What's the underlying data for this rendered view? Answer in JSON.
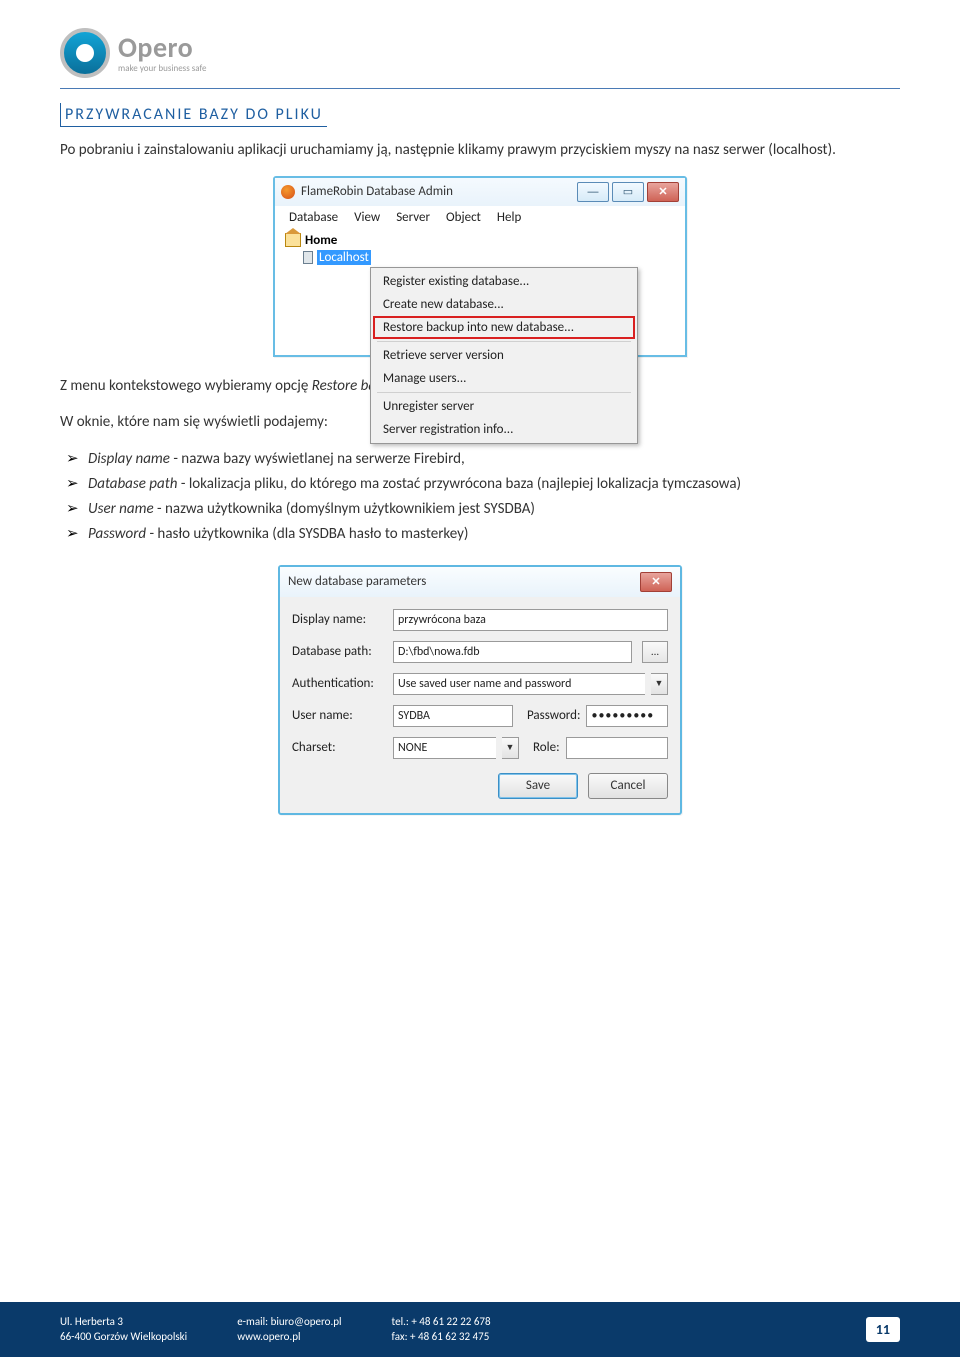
{
  "logo": {
    "brand": "Opero",
    "tagline": "make your business safe"
  },
  "section_title": "PRZYWRACANIE BAZY DO PLIKU",
  "para_intro": "Po pobraniu i zainstalowaniu aplikacji uruchamiamy ją, następnie klikamy prawym przyciskiem myszy na nasz serwer (localhost).",
  "flamerobin": {
    "title": "FlameRobin Database Admin",
    "menu": [
      "Database",
      "View",
      "Server",
      "Object",
      "Help"
    ],
    "tree": {
      "root": "Home",
      "selected": "Localhost"
    },
    "context": {
      "g1": [
        "Register existing database...",
        "Create new database..."
      ],
      "highlight": "Restore backup into new database...",
      "g2": [
        "Retrieve server version",
        "Manage users..."
      ],
      "g3": [
        "Unregister server",
        "Server registration info..."
      ]
    }
  },
  "para_mid": "Z menu kontekstowego wybieramy opcję ",
  "para_mid_em": "Restore backup into new database...",
  "para_list_intro": "W oknie, które nam się wyświetli podajemy:",
  "bullets": [
    {
      "em": "Display name",
      "rest": " - nazwa bazy wyświetlanej na serwerze Firebird,"
    },
    {
      "em": "Database path",
      "rest": " - lokalizacja pliku, do którego ma zostać przywrócona baza (najlepiej lokalizacja tymczasowa)"
    },
    {
      "em": "User name",
      "rest": " - nazwa użytkownika (domyślnym użytkownikiem jest SYSDBA)"
    },
    {
      "em": "Password",
      "rest": " - hasło użytkownika (dla SYSDBA hasło to masterkey)"
    }
  ],
  "dialog": {
    "title": "New database parameters",
    "labels": {
      "display": "Display name:",
      "path": "Database path:",
      "auth": "Authentication:",
      "user": "User name:",
      "pwd": "Password:",
      "charset": "Charset:",
      "role": "Role:"
    },
    "values": {
      "display": "przywrócona baza",
      "path": "D:\\fbd\\nowa.fdb",
      "auth": "Use saved user name and password",
      "user": "SYDBA",
      "pwd": "•••••••••",
      "charset": "NONE",
      "role": ""
    },
    "buttons": {
      "save": "Save",
      "cancel": "Cancel"
    }
  },
  "footer": {
    "addr1": "Ul. Herberta 3",
    "addr2": "66-400 Gorzów Wielkopolski",
    "email": "e-mail: biuro@opero.pl",
    "www": "www.opero.pl",
    "tel": "tel.: + 48 61 22 22 678",
    "fax": "fax: + 48 61 62 32 475",
    "page": "11"
  }
}
